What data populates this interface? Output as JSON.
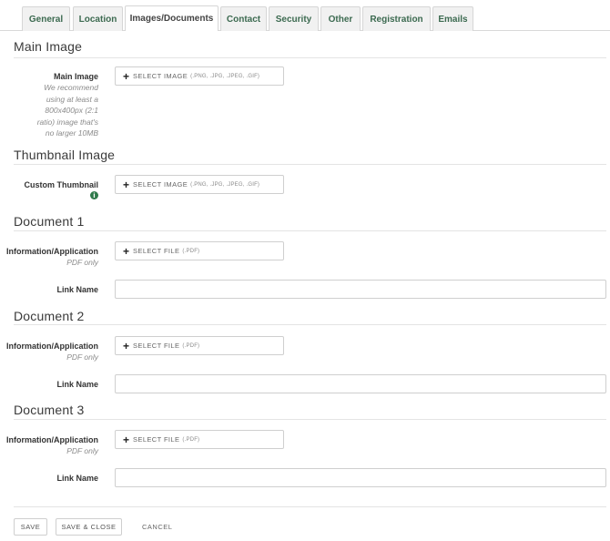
{
  "tabs": [
    {
      "label": "General"
    },
    {
      "label": "Location"
    },
    {
      "label": "Images/Documents"
    },
    {
      "label": "Contact"
    },
    {
      "label": "Security"
    },
    {
      "label": "Other"
    },
    {
      "label": "Registration"
    },
    {
      "label": "Emails"
    }
  ],
  "active_tab": "Images/Documents",
  "main_image": {
    "section_title": "Main Image",
    "label": "Main Image",
    "hint_lines": [
      "We recommend",
      "using at least a",
      "800x400px (2:1",
      "ratio) image that's",
      "no larger 10MB"
    ],
    "button_text": "SELECT IMAGE",
    "button_ext": "(.PNG, .JPG, .JPEG, .GIF)"
  },
  "thumbnail": {
    "section_title": "Thumbnail Image",
    "label": "Custom Thumbnail",
    "info_icon": "info-icon",
    "button_text": "SELECT IMAGE",
    "button_ext": "(.PNG, .JPG, .JPEG, .GIF)"
  },
  "documents": [
    {
      "section_title": "Document 1",
      "file_label": "Information/Application",
      "file_hint": "PDF only",
      "button_text": "SELECT FILE",
      "button_ext": "(.PDF)",
      "link_label": "Link Name",
      "link_value": ""
    },
    {
      "section_title": "Document 2",
      "file_label": "Information/Application",
      "file_hint": "PDF only",
      "button_text": "SELECT FILE",
      "button_ext": "(.PDF)",
      "link_label": "Link Name",
      "link_value": ""
    },
    {
      "section_title": "Document 3",
      "file_label": "Information/Application",
      "file_hint": "PDF only",
      "button_text": "SELECT FILE",
      "button_ext": "(.PDF)",
      "link_label": "Link Name",
      "link_value": ""
    }
  ],
  "footer": {
    "save": "SAVE",
    "save_close": "SAVE & CLOSE",
    "cancel": "CANCEL"
  },
  "colors": {
    "tab_text": "#3c6a50",
    "info_icon": "#2f7a4a"
  }
}
